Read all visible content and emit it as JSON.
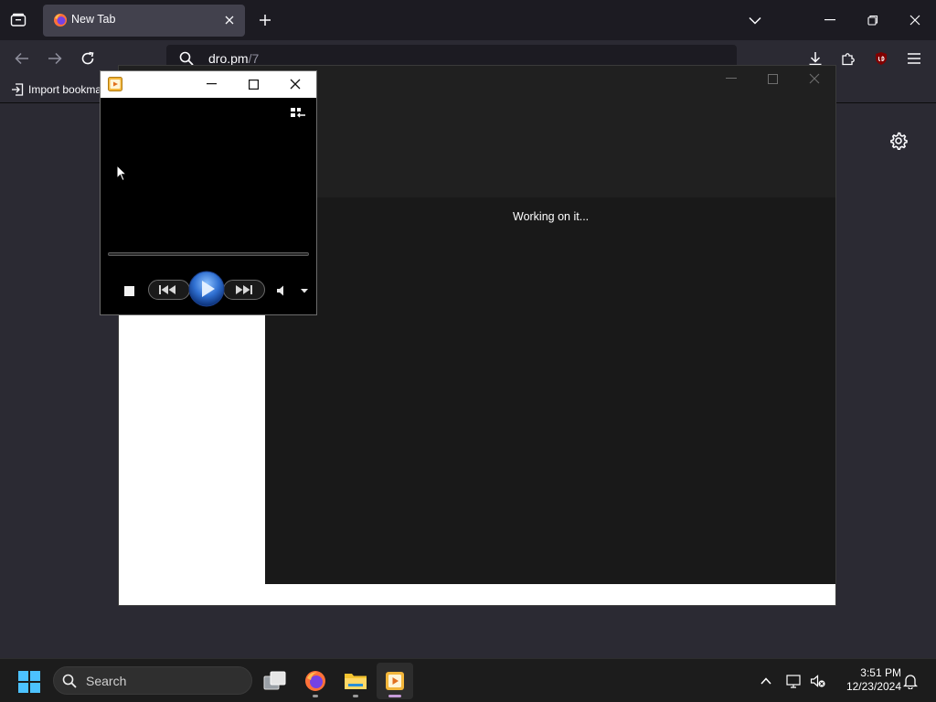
{
  "browser": {
    "tab": {
      "title": "New Tab"
    },
    "address": {
      "host": "dro.pm",
      "path": "/7"
    },
    "bookmarks": {
      "import_label": "Import bookmarks..."
    }
  },
  "wmp_main": {
    "status_text": "Working on it..."
  },
  "wmp_mini": {
    "title": ""
  },
  "taskbar": {
    "search_label": "Search",
    "clock": {
      "time": "3:51 PM",
      "date": "12/23/2024"
    },
    "pinned_apps": [
      "task-view",
      "firefox",
      "file-explorer",
      "media-player"
    ]
  },
  "colors": {
    "chrome_dark": "#1c1b22",
    "chrome": "#2b2a33",
    "tab_active": "#42414d",
    "library_bg": "#191919",
    "play_button": "#2f6fd1",
    "taskbar": "#1c1c1c",
    "media_player_indicator": "#c69bd9"
  }
}
